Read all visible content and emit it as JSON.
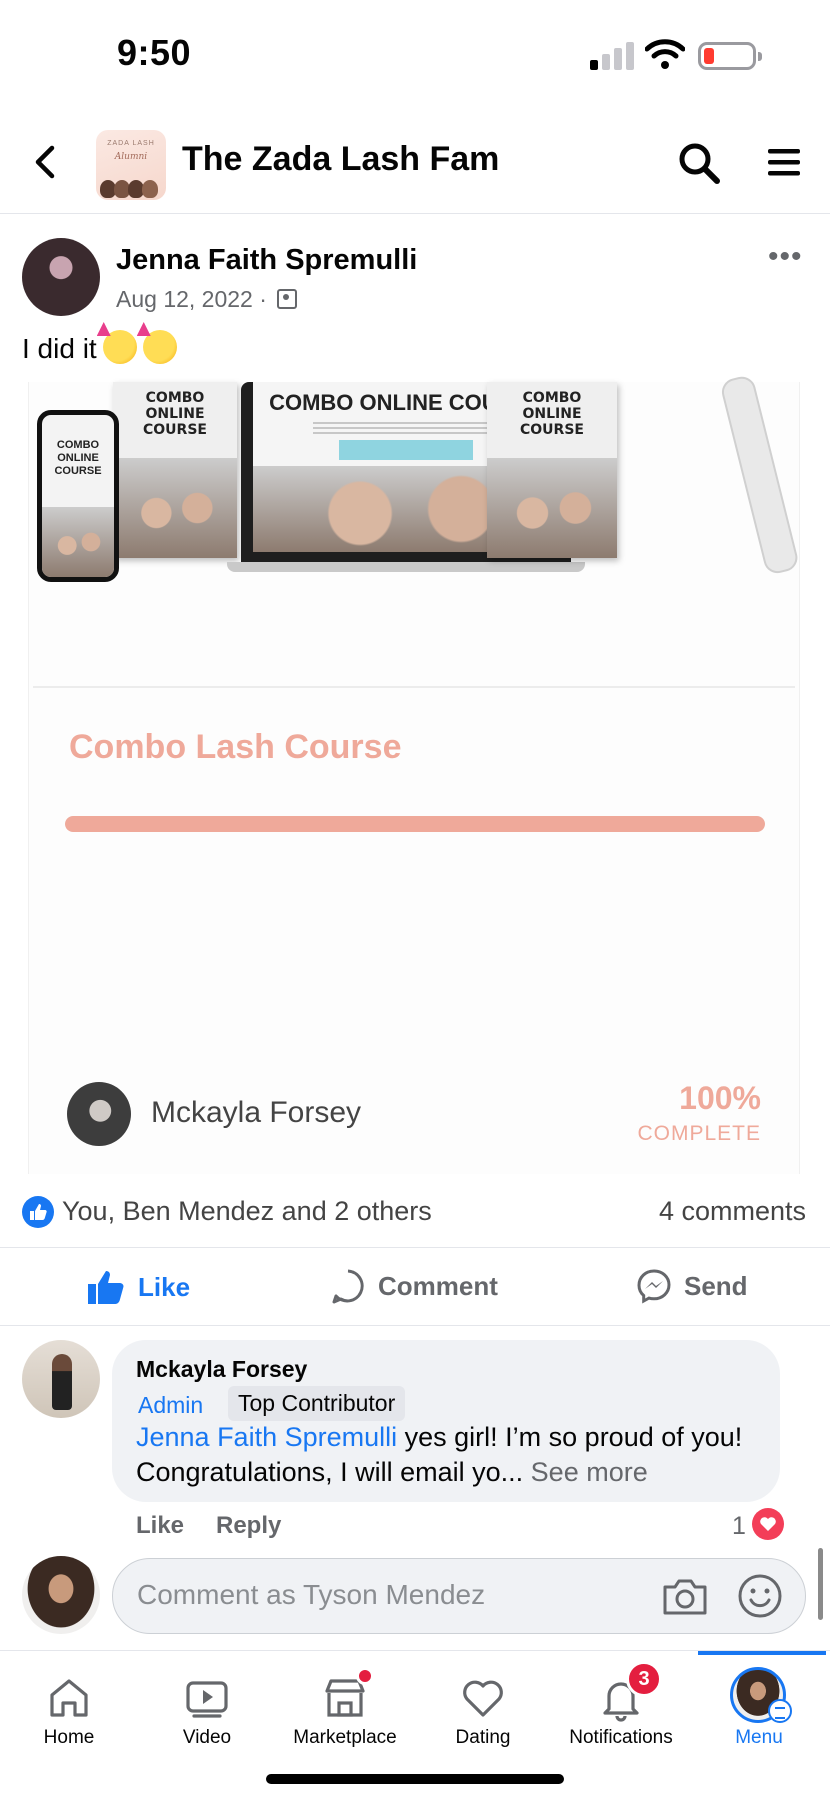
{
  "status_bar": {
    "time": "9:50"
  },
  "header": {
    "group_name": "The Zada Lash Fam",
    "thumb_line1": "ZADA LASH",
    "thumb_line2": "Alumni"
  },
  "post": {
    "author": "Jenna Faith Spremulli",
    "date": "Aug 12, 2022 ·",
    "text": "I did it",
    "more_label": "•••"
  },
  "shared_image": {
    "mock_title": "COMBO ONLINE COURSE",
    "book_title": "COMBO ONLINE COURSE",
    "phone_title": "COMBO ONLINE COURSE",
    "course_title": "Combo Lash Course",
    "progress_fraction": 1.0,
    "instructor": "Mckayla Forsey",
    "percent": "100%",
    "complete_label": "COMPLETE"
  },
  "reactions": {
    "text": "You, Ben Mendez and 2 others",
    "comments": "4 comments"
  },
  "actions": {
    "like": "Like",
    "comment": "Comment",
    "send": "Send"
  },
  "comment": {
    "author": "Mckayla Forsey",
    "badge_admin": "Admin",
    "badge_top": "Top Contributor",
    "mention": "Jenna Faith Spremulli",
    "text": " yes girl! I’m so proud of you! Congratulations, I will email yo...",
    "see_more": " See more",
    "like": "Like",
    "reply": "Reply",
    "reaction_count": "1"
  },
  "comment_input": {
    "placeholder": "Comment as Tyson Mendez"
  },
  "bottom_nav": {
    "items": [
      {
        "label": "Home",
        "icon": "home-icon"
      },
      {
        "label": "Video",
        "icon": "video-icon"
      },
      {
        "label": "Marketplace",
        "icon": "marketplace-icon"
      },
      {
        "label": "Dating",
        "icon": "dating-icon"
      },
      {
        "label": "Notifications",
        "icon": "bell-icon"
      },
      {
        "label": "Menu",
        "icon": "menu-avatar"
      }
    ],
    "notifications_badge": "3",
    "active": "Menu"
  },
  "colors": {
    "accent": "#1877f2",
    "course_pink": "#efa99a",
    "badge_red": "#e41e3f"
  }
}
